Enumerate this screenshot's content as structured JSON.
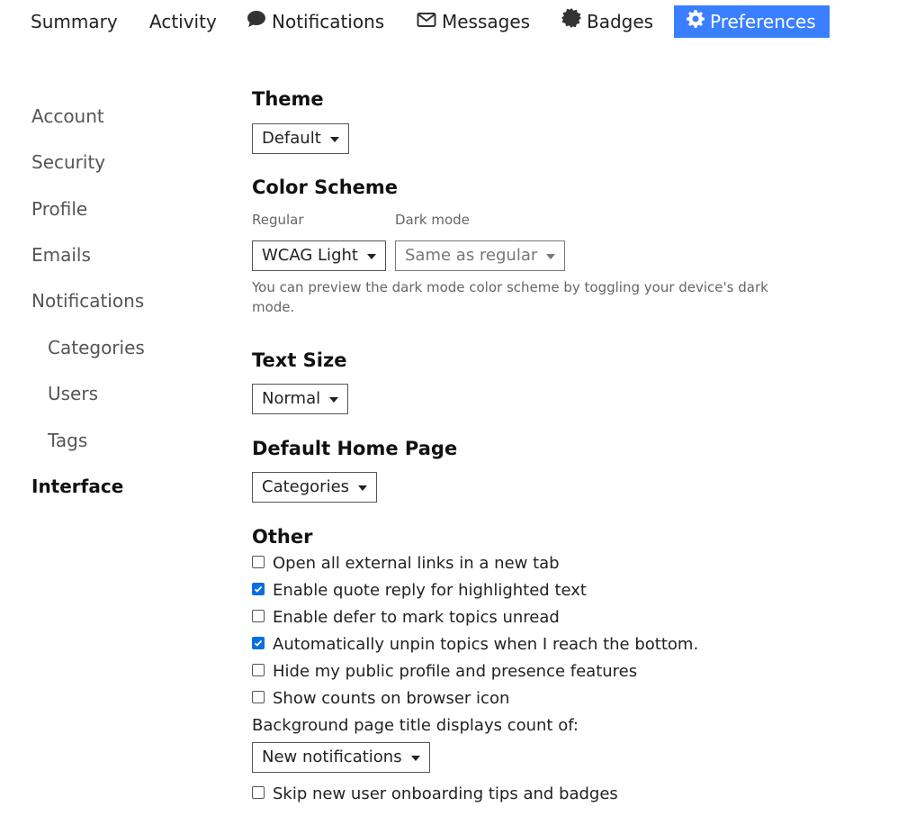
{
  "nav": {
    "tabs": [
      {
        "label": "Summary",
        "icon": ""
      },
      {
        "label": "Activity",
        "icon": ""
      },
      {
        "label": "Notifications",
        "icon": "comment-icon"
      },
      {
        "label": "Messages",
        "icon": "envelope-icon"
      },
      {
        "label": "Badges",
        "icon": "badge-icon"
      },
      {
        "label": "Preferences",
        "icon": "gear-icon",
        "active": true
      }
    ],
    "active_color": "#3a7fff"
  },
  "sidebar": {
    "items": [
      {
        "label": "Account"
      },
      {
        "label": "Security"
      },
      {
        "label": "Profile"
      },
      {
        "label": "Emails"
      },
      {
        "label": "Notifications"
      },
      {
        "label": "Categories",
        "indent": true
      },
      {
        "label": "Users",
        "indent": true
      },
      {
        "label": "Tags",
        "indent": true
      },
      {
        "label": "Interface",
        "active": true
      }
    ]
  },
  "main": {
    "theme": {
      "heading": "Theme",
      "value": "Default"
    },
    "color_scheme": {
      "heading": "Color Scheme",
      "regular_label": "Regular",
      "regular_value": "WCAG Light",
      "dark_label": "Dark mode",
      "dark_value": "Same as regular",
      "help": "You can preview the dark mode color scheme by toggling your device's dark mode."
    },
    "text_size": {
      "heading": "Text Size",
      "value": "Normal"
    },
    "home_page": {
      "heading": "Default Home Page",
      "value": "Categories"
    },
    "other": {
      "heading": "Other",
      "options": [
        {
          "label": "Open all external links in a new tab",
          "checked": false
        },
        {
          "label": "Enable quote reply for highlighted text",
          "checked": true
        },
        {
          "label": "Enable defer to mark topics unread",
          "checked": false
        },
        {
          "label": "Automatically unpin topics when I reach the bottom.",
          "checked": true
        },
        {
          "label": "Hide my public profile and presence features",
          "checked": false
        },
        {
          "label": "Show counts on browser icon",
          "checked": false
        }
      ],
      "title_count_label": "Background page title displays count of:",
      "title_count_value": "New notifications",
      "skip_onboarding": {
        "label": "Skip new user onboarding tips and badges",
        "checked": false
      }
    }
  },
  "colors": {
    "checkbox_checked": "#0b6ee0"
  }
}
